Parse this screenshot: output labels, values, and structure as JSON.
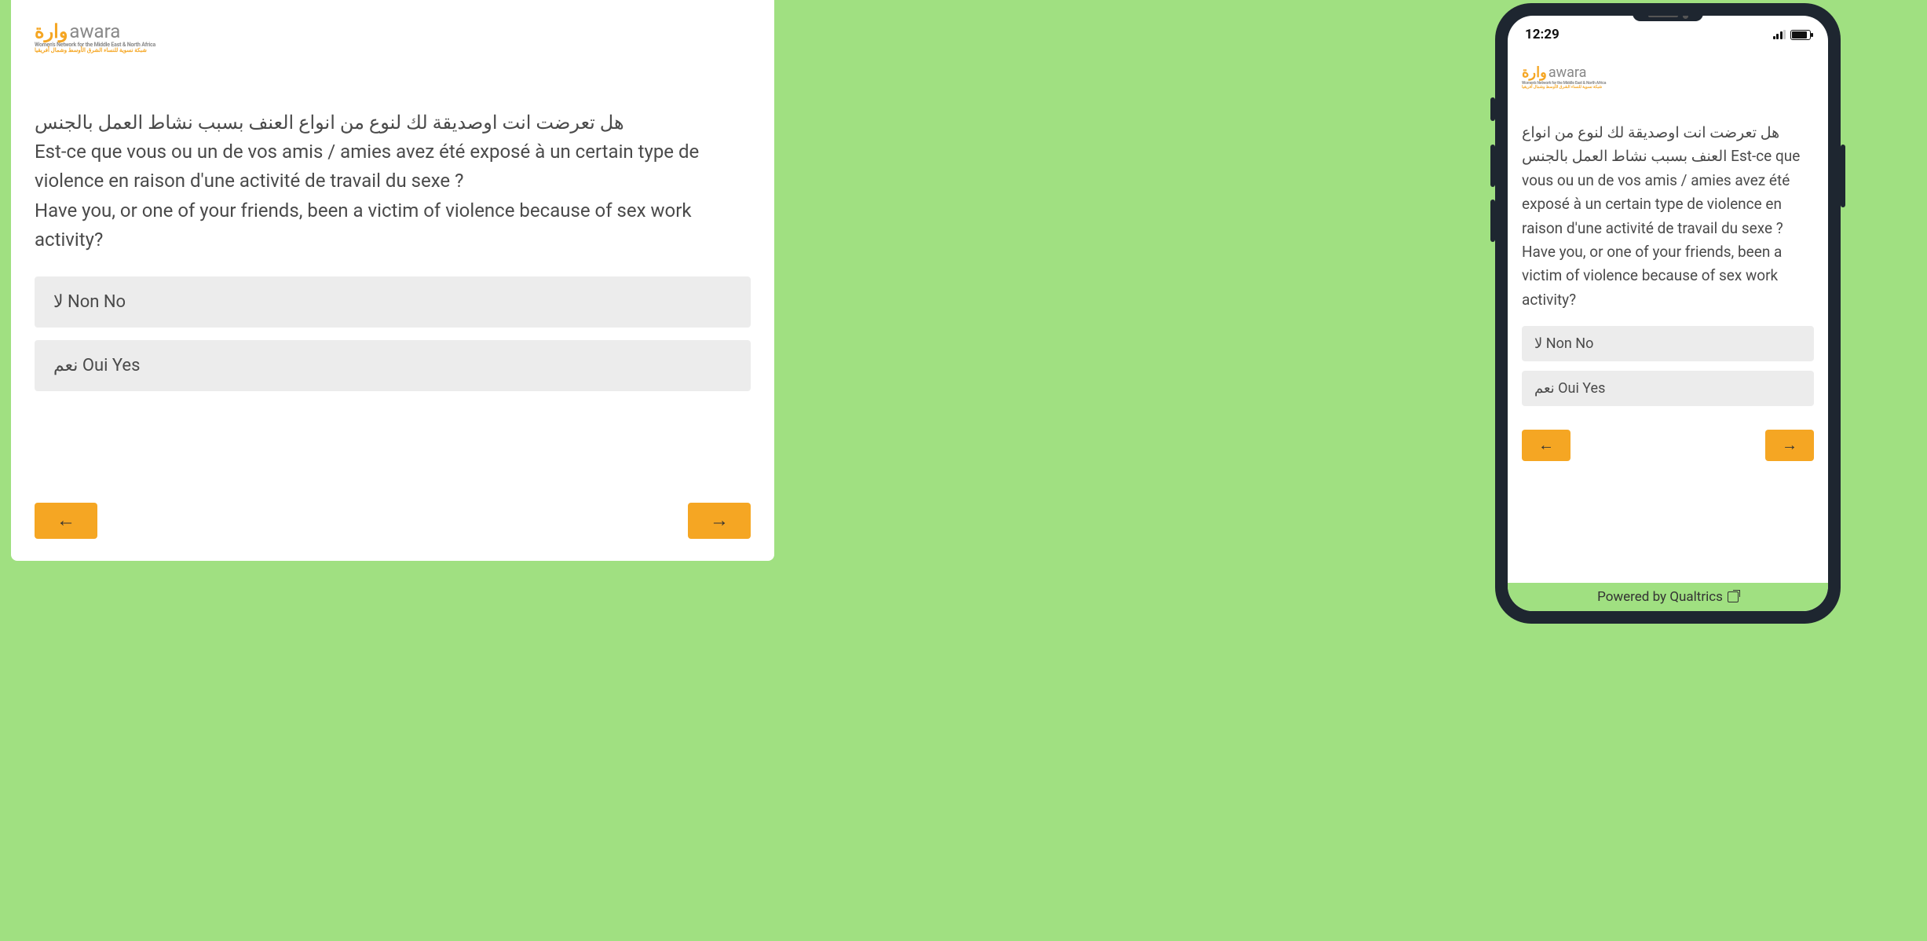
{
  "logo": {
    "arabic": "وارة",
    "english": "awara",
    "tagline1": "Women's Network for the Middle East & North Africa",
    "tagline2": "شبكة نسوية للنساء الشرق الأوسط وشمال أفريقيا"
  },
  "question": {
    "arabic": "هل تعرضت انت اوصديقة لك لنوع من انواع العنف بسبب نشاط العمل بالجنس",
    "french": "Est-ce que vous ou un de vos amis / amies avez été exposé à un certain type de violence en raison d'une activité de travail du sexe ?",
    "english": "Have you, or one of your friends, been a victim of violence because of sex work activity?"
  },
  "options": [
    "لا Non No",
    "نعم Oui Yes"
  ],
  "statusbar": {
    "time": "12:29"
  },
  "footer": {
    "powered": "Powered by Qualtrics"
  },
  "nav": {
    "prev": "←",
    "next": "→"
  }
}
